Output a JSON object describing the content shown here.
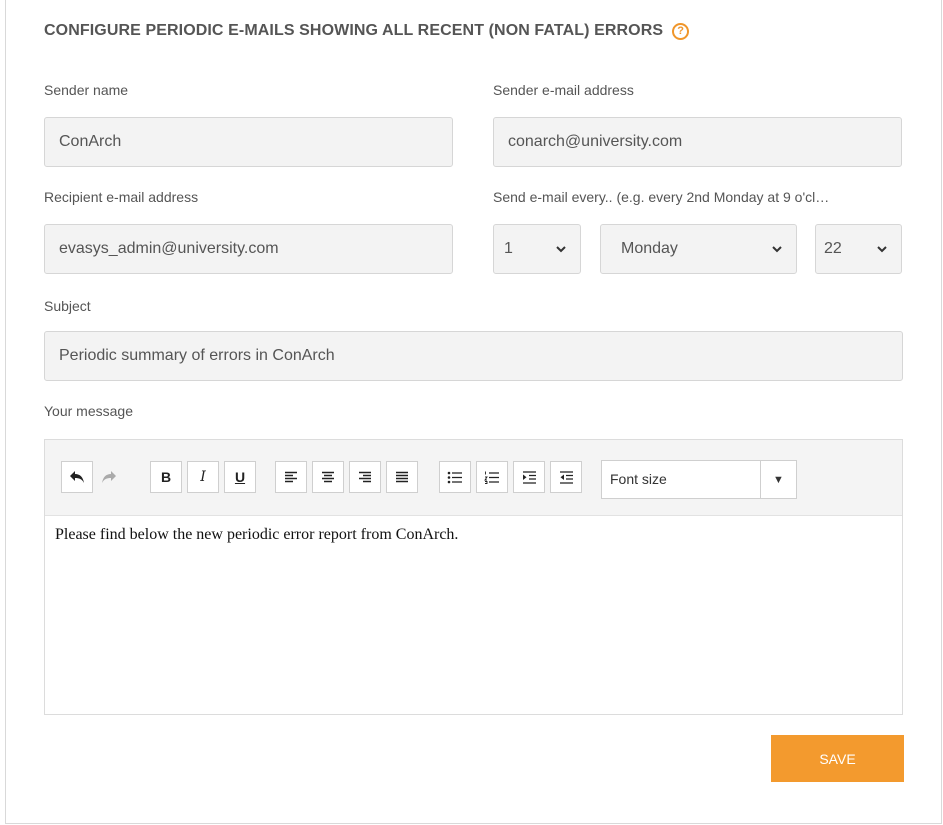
{
  "page": {
    "title": "CONFIGURE PERIODIC E-MAILS SHOWING ALL RECENT (NON FATAL) ERRORS",
    "help_icon": "?"
  },
  "form": {
    "sender_name": {
      "label": "Sender name",
      "value": "ConArch"
    },
    "sender_email": {
      "label": "Sender e-mail address",
      "value": "conarch@university.com"
    },
    "recipient_email": {
      "label": "Recipient e-mail address",
      "value": "evasys_admin@university.com"
    },
    "schedule": {
      "label": "Send e-mail every.. (e.g. every 2nd Monday at 9 o'cl…",
      "interval": "1",
      "weekday": "Monday",
      "hour": "22"
    },
    "subject": {
      "label": "Subject",
      "value": "Periodic summary of errors in ConArch"
    },
    "message": {
      "label": "Your message",
      "body": "Please find below the new periodic error report from ConArch.",
      "font_size_placeholder": "Font size"
    }
  },
  "toolbar": {
    "bold": "B",
    "italic": "I",
    "underline": "U",
    "dropdown_arrow": "▼"
  },
  "actions": {
    "save_label": "SAVE"
  },
  "colors": {
    "accent": "#f39a2e",
    "help": "#f0962a"
  }
}
